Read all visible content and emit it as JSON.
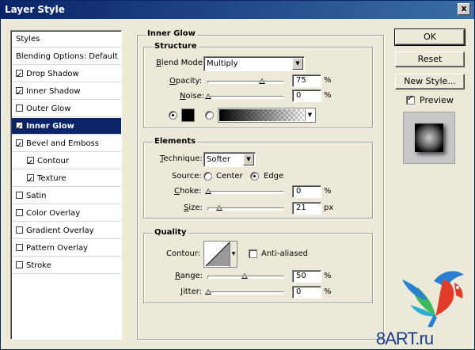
{
  "window": {
    "title": "Layer Style",
    "close_glyph": "x"
  },
  "styles": {
    "header": "Styles",
    "items": [
      {
        "label": "Blending Options: Default",
        "checkbox": false,
        "checked": false
      },
      {
        "label": "Drop Shadow",
        "checkbox": true,
        "checked": true
      },
      {
        "label": "Inner Shadow",
        "checkbox": true,
        "checked": true
      },
      {
        "label": "Outer Glow",
        "checkbox": true,
        "checked": false
      },
      {
        "label": "Inner Glow",
        "checkbox": true,
        "checked": true,
        "selected": true
      },
      {
        "label": "Bevel and Emboss",
        "checkbox": true,
        "checked": true
      },
      {
        "label": "Contour",
        "checkbox": true,
        "checked": true,
        "indent": true
      },
      {
        "label": "Texture",
        "checkbox": true,
        "checked": true,
        "indent": true
      },
      {
        "label": "Satin",
        "checkbox": true,
        "checked": false
      },
      {
        "label": "Color Overlay",
        "checkbox": true,
        "checked": false
      },
      {
        "label": "Gradient Overlay",
        "checkbox": true,
        "checked": false
      },
      {
        "label": "Pattern Overlay",
        "checkbox": true,
        "checked": false
      },
      {
        "label": "Stroke",
        "checkbox": true,
        "checked": false
      }
    ]
  },
  "inner_glow": {
    "title": "Inner Glow",
    "structure": {
      "title": "Structure",
      "blend_mode_label_u": "B",
      "blend_mode_label_rest": "lend Mode:",
      "blend_mode_value": "Multiply",
      "opacity_label_u": "O",
      "opacity_label_rest": "pacity:",
      "opacity_value": "75",
      "opacity_level": 75,
      "opacity_unit": "%",
      "noise_label_u": "N",
      "noise_label_rest": "oise:",
      "noise_value": "0",
      "noise_level": 0,
      "noise_unit": "%",
      "color_swatch": "#000000"
    },
    "elements": {
      "title": "Elements",
      "technique_label_u": "T",
      "technique_label_rest": "echnique:",
      "technique_value": "Softer",
      "source_label": "Source:",
      "source_center": "Center",
      "source_edge": "Edge",
      "choke_label_u": "C",
      "choke_label_rest": "hoke:",
      "choke_value": "0",
      "choke_level": 0,
      "choke_unit": "%",
      "size_label_u": "S",
      "size_label_rest": "ize:",
      "size_value": "21",
      "size_unit": "px"
    },
    "quality": {
      "title": "Quality",
      "contour_label": "Contour:",
      "anti_aliased_label": "Anti-aliased",
      "range_label_u": "R",
      "range_label_rest": "ange:",
      "range_value": "50",
      "range_level": 50,
      "range_unit": "%",
      "jitter_label_u": "J",
      "jitter_label_rest": "itter:",
      "jitter_value": "0",
      "jitter_level": 0,
      "jitter_unit": "%"
    }
  },
  "buttons": {
    "ok": "OK",
    "reset": "Reset",
    "new_style": "New Style...",
    "preview_label": "Preview"
  },
  "watermark": {
    "text": "8ART.ru"
  }
}
